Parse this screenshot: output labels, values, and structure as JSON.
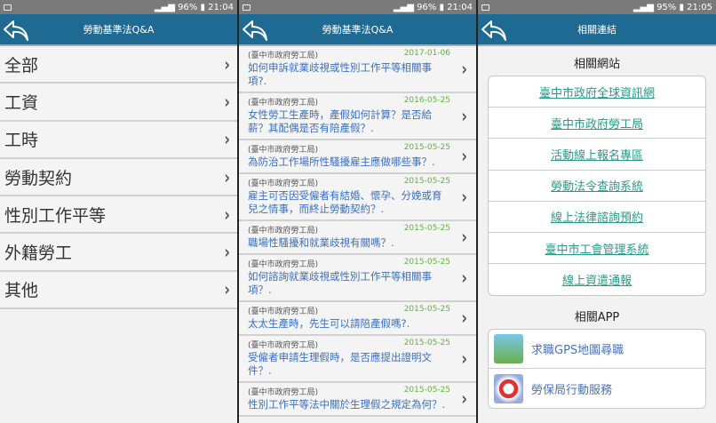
{
  "screens": [
    {
      "status": {
        "battery": "96%",
        "time": "21:04"
      },
      "title": "勞動基準法Q&A"
    },
    {
      "status": {
        "battery": "96%",
        "time": "21:04"
      },
      "title": "勞動基準法Q&A"
    },
    {
      "status": {
        "battery": "95%",
        "time": "21:05"
      },
      "title": "相關連結"
    }
  ],
  "categories": [
    "全部",
    "工資",
    "工時",
    "勞動契約",
    "性別工作平等",
    "外籍勞工",
    "其他"
  ],
  "qa": [
    {
      "source": "(臺中市政府勞工局)",
      "date": "2017-01-06",
      "q": "如何申訴就業歧視或性別工作平等相關事項?."
    },
    {
      "source": "(臺中市政府勞工局)",
      "date": "2016-05-25",
      "q": "女性勞工生產時，產假如何計算？是否給薪？其配偶是否有陪產假？."
    },
    {
      "source": "(臺中市政府勞工局)",
      "date": "2015-05-25",
      "q": "為防治工作場所性騷擾雇主應做哪些事？."
    },
    {
      "source": "(臺中市政府勞工局)",
      "date": "2015-05-25",
      "q": "雇主可否因受僱者有結婚、懷孕、分娩或育兒之情事，而終止勞動契約？."
    },
    {
      "source": "(臺中市政府勞工局)",
      "date": "2015-05-25",
      "q": "職場性騷擾和就業歧視有關嗎？."
    },
    {
      "source": "(臺中市政府勞工局)",
      "date": "2015-05-25",
      "q": "如何諮詢就業歧視或性別工作平等相關事項？."
    },
    {
      "source": "(臺中市政府勞工局)",
      "date": "2015-05-25",
      "q": "太太生產時，先生可以請陪產假嗎?."
    },
    {
      "source": "(臺中市政府勞工局)",
      "date": "2015-05-25",
      "q": "受僱者申請生理假時，是否應提出證明文件？."
    },
    {
      "source": "(臺中市政府勞工局)",
      "date": "2015-05-25",
      "q": "性別工作平等法中關於生理假之規定為何？."
    }
  ],
  "links": {
    "websites_title": "相關網站",
    "websites": [
      "臺中市政府全球資訊網",
      "臺中市政府勞工局",
      "活動線上報名專區",
      "勞動法令查詢系統",
      "線上法律諮詢預約",
      "臺中市工會管理系統",
      "線上資遣通報"
    ],
    "apps_title": "相關APP",
    "apps": [
      "求職GPS地圖尋職",
      "勞保局行動服務"
    ]
  },
  "chevron": "›"
}
